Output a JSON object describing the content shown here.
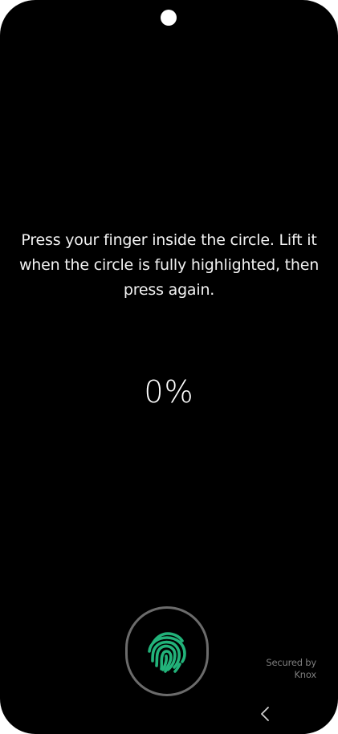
{
  "screen": {
    "instruction": "Press your finger inside the circle. Lift it when the circle is fully highlighted, then press again.",
    "progress_text": "0%",
    "secured_line1": "Secured by",
    "secured_line2": "Knox"
  },
  "icons": {
    "fingerprint": "fingerprint-icon",
    "back": "chevron-left-icon",
    "camera": "front-camera"
  },
  "colors": {
    "background": "#000000",
    "fingerprint": "#22b37a",
    "ring": "#6b6b6b",
    "text": "#f2f2f2",
    "secondary_text": "#7d7d7d"
  }
}
